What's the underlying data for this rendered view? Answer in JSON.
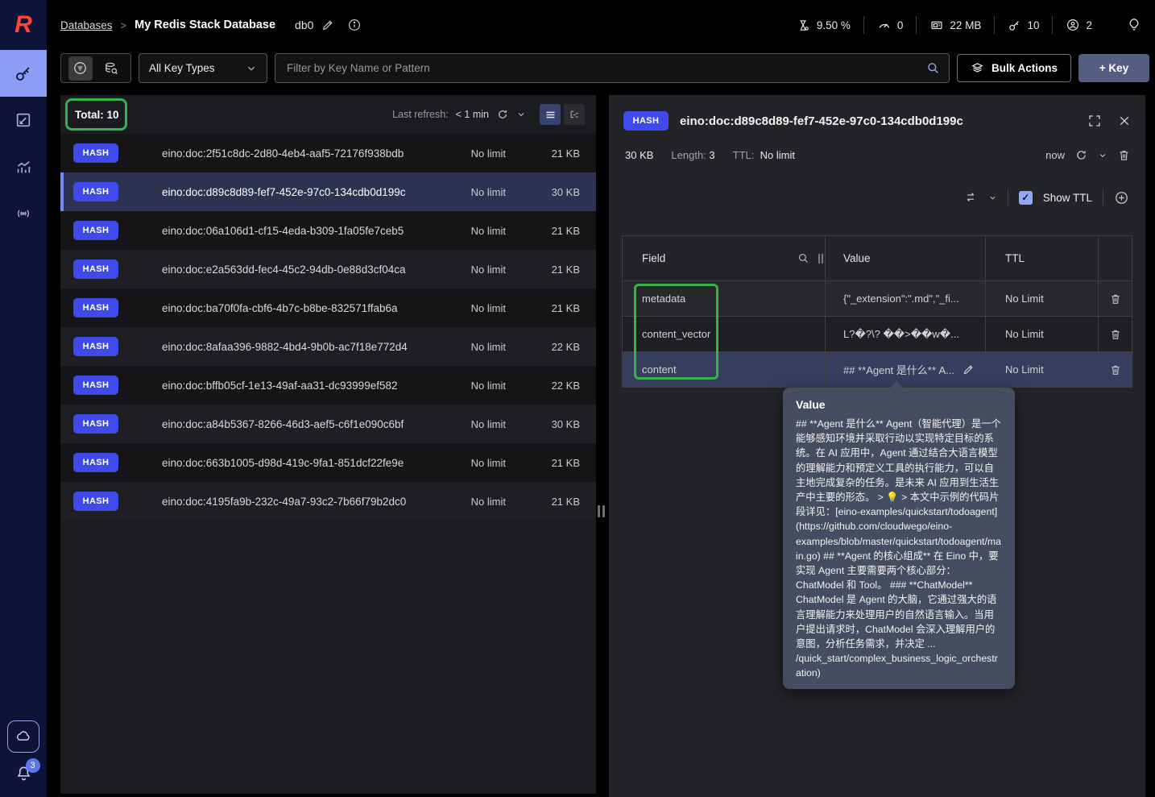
{
  "topbar": {
    "breadcrumb": {
      "root": "Databases",
      "separator": ">",
      "current": "My Redis Stack Database",
      "db": "db0"
    },
    "stats": {
      "cpu": "9.50 %",
      "commands": "0",
      "memory": "22 MB",
      "keys": "10",
      "clients": "2"
    }
  },
  "filter": {
    "key_type_selected": "All Key Types",
    "search_placeholder": "Filter by Key Name or Pattern",
    "bulk_actions_label": "Bulk Actions",
    "add_key_label": "+ Key"
  },
  "key_list": {
    "total_label": "Total: 10",
    "last_refresh_label": "Last refresh:",
    "last_refresh_value": "< 1 min",
    "badge": "HASH",
    "rows": [
      {
        "name": "eino:doc:2f51c8dc-2d80-4eb4-aaf5-72176f938bdb",
        "ttl": "No limit",
        "size": "21 KB"
      },
      {
        "name": "eino:doc:d89c8d89-fef7-452e-97c0-134cdb0d199c",
        "ttl": "No limit",
        "size": "30 KB"
      },
      {
        "name": "eino:doc:06a106d1-cf15-4eda-b309-1fa05fe7ceb5",
        "ttl": "No limit",
        "size": "21 KB"
      },
      {
        "name": "eino:doc:e2a563dd-fec4-45c2-94db-0e88d3cf04ca",
        "ttl": "No limit",
        "size": "21 KB"
      },
      {
        "name": "eino:doc:ba70f0fa-cbf6-4b7c-b8be-832571ffab6a",
        "ttl": "No limit",
        "size": "21 KB"
      },
      {
        "name": "eino:doc:8afaa396-9882-4bd4-9b0b-ac7f18e772d4",
        "ttl": "No limit",
        "size": "22 KB"
      },
      {
        "name": "eino:doc:bffb05cf-1e13-49af-aa31-dc93999ef582",
        "ttl": "No limit",
        "size": "22 KB"
      },
      {
        "name": "eino:doc:a84b5367-8266-46d3-aef5-c6f1e090c6bf",
        "ttl": "No limit",
        "size": "30 KB"
      },
      {
        "name": "eino:doc:663b1005-d98d-419c-9fa1-851dcf22fe9e",
        "ttl": "No limit",
        "size": "21 KB"
      },
      {
        "name": "eino:doc:4195fa9b-232c-49a7-93c2-7b66f79b2dc0",
        "ttl": "No limit",
        "size": "21 KB"
      }
    ]
  },
  "detail": {
    "badge": "HASH",
    "key_name": "eino:doc:d89c8d89-fef7-452e-97c0-134cdb0d199c",
    "size": "30 KB",
    "length_label": "Length:",
    "length_value": "3",
    "ttl_label": "TTL:",
    "ttl_value": "No limit",
    "refresh_time": "now",
    "show_ttl_label": "Show TTL",
    "table": {
      "headers": {
        "field": "Field",
        "value": "Value",
        "ttl": "TTL"
      },
      "rows": [
        {
          "field": "metadata",
          "value": "{\"_extension\":\".md\",\"_fi...",
          "ttl": "No Limit"
        },
        {
          "field": "content_vector",
          "value": "L?�?\\? ��>��w�...",
          "ttl": "No Limit"
        },
        {
          "field": "content",
          "value": "## **Agent 是什么** A...",
          "ttl": "No Limit"
        }
      ]
    },
    "tooltip": {
      "title": "Value",
      "body": "## **Agent 是什么** Agent（智能代理）是一个能够感知环境并采取行动以实现特定目标的系统。在 AI 应用中，Agent 通过结合大语言模型的理解能力和预定义工具的执行能力，可以自主地完成复杂的任务。是未来 AI 应用到生活生产中主要的形态。 > 💡 > 本文中示例的代码片段详见：[eino-examples/quickstart/todoagent](https://github.com/cloudwego/eino-examples/blob/master/quickstart/todoagent/main.go) ## **Agent 的核心组成** 在 Eino 中，要实现 Agent 主要需要两个核心部分：ChatModel 和 Tool。 ### **ChatModel** ChatModel 是 Agent 的大脑，它通过强大的语言理解能力来处理用户的自然语言输入。当用户提出请求时，ChatModel 会深入理解用户的意图，分析任务需求，并决定 ... /quick_start/complex_business_logic_orchestration)"
    }
  },
  "sidebar": {
    "notifications_count": "3"
  },
  "colors": {
    "hash_badge": "#3f4aea",
    "annotation_green": "#35b24a",
    "selected_row": "#2d3253",
    "accent_periwinkle": "#8c9df6",
    "add_key_button": "#535e82",
    "tooltip_bg": "#454e61"
  }
}
